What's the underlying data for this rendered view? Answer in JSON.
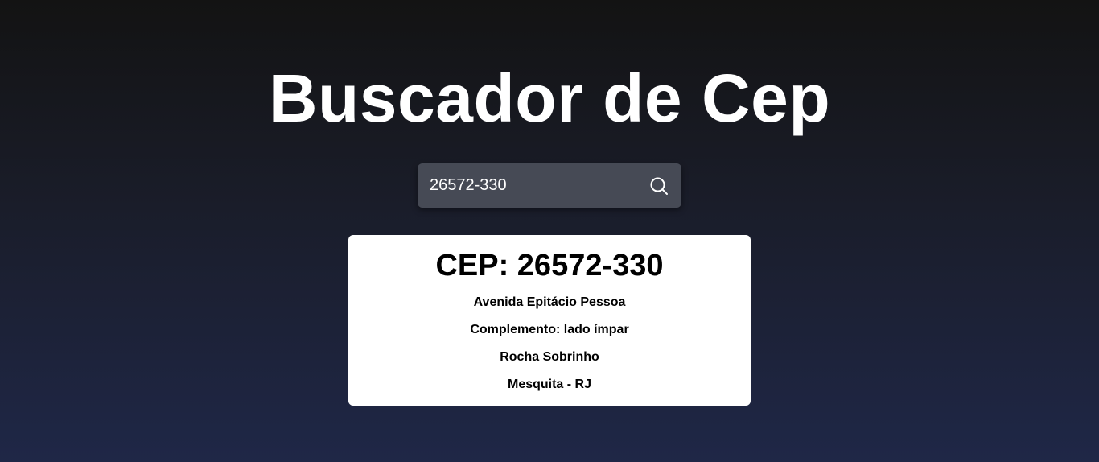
{
  "header": {
    "title": "Buscador de Cep"
  },
  "search": {
    "value": "26572-330",
    "icon": "search-icon"
  },
  "result": {
    "cep_heading": "CEP: 26572-330",
    "street": "Avenida Epitácio Pessoa",
    "complement": "Complemento: lado ímpar",
    "neighborhood": "Rocha Sobrinho",
    "city_state": "Mesquita - RJ"
  },
  "colors": {
    "background_top": "#131313",
    "background_bottom": "#1f2747",
    "search_box": "#464a55",
    "card": "#ffffff",
    "title_text": "#ffffff"
  }
}
